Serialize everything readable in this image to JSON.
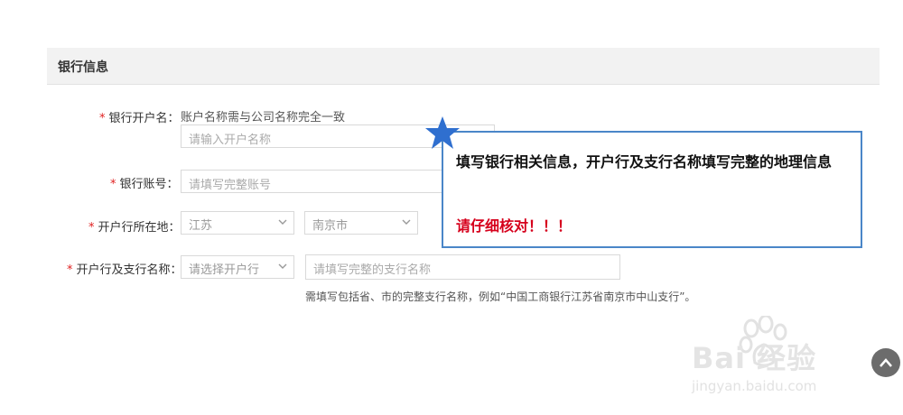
{
  "section": {
    "title": "银行信息"
  },
  "form": {
    "account_name": {
      "label": "银行开户名：",
      "hint": "账户名称需与公司名称完全一致",
      "placeholder": "请输入开户名称"
    },
    "account_number": {
      "label": "银行账号：",
      "placeholder": "请填写完整账号"
    },
    "bank_location": {
      "label": "开户行所在地：",
      "province": "江苏",
      "city": "南京市"
    },
    "branch": {
      "label": "开户行及支行名称：",
      "select_placeholder": "请选择开户行",
      "input_placeholder": "请填写完整的支行名称",
      "note": "需填写包括省、市的完整支行名称，例如“中国工商银行江苏省南京市中山支行”。"
    },
    "required_mark": "*"
  },
  "callout": {
    "line1": "填写银行相关信息，开户行及支行名称填写完整的地理信息",
    "line2": "请仔细核对！！！",
    "border_color": "#4a86c8",
    "warning_color": "#d6001c"
  },
  "watermark": {
    "logo": "Bai  经验",
    "url": "jingyan.baidu.com"
  },
  "icons": {
    "star": "star-icon",
    "chevron": "chevron-down-icon",
    "scroll_top": "chevron-up-icon"
  }
}
